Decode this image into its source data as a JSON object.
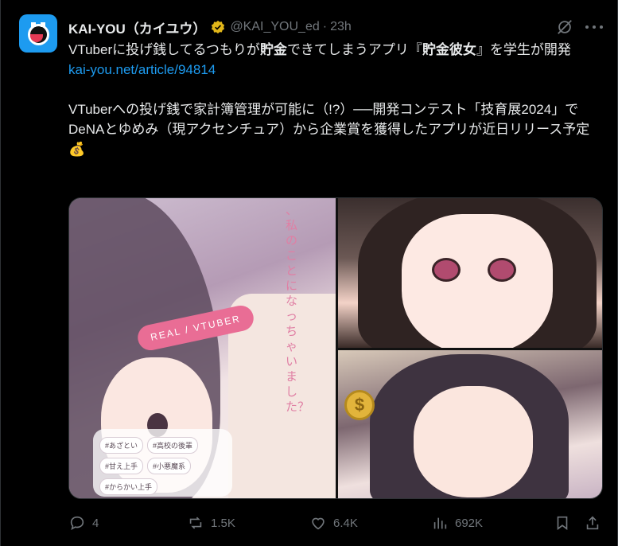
{
  "author": {
    "name": "KAI-YOU（カイユウ）",
    "handle": "@KAI_YOU_ed",
    "separator": "·",
    "time": "23h"
  },
  "tweet": {
    "line1_a": "VTuberに投げ銭してるつもりが",
    "line1_b": "貯金",
    "line1_c": "できてしまうアプリ『",
    "line1_d": "貯金彼女",
    "line1_e": "』を学生が開発",
    "link": "kai-you.net/article/94814",
    "para2": "VTuberへの投げ銭で家計簿管理が可能に（!?）──開発コンテスト「技育展2024」でDeNAとゆめみ（現アクセンチュア）から企業賞を獲得したアプリが近日リリース予定💰"
  },
  "media": {
    "img1": {
      "vertical_text": "、私のことになっちゃいました？",
      "pill": "REAL / VTUBER",
      "tags": [
        "#あざとい",
        "#高校の後輩",
        "#甘え上手",
        "#小悪魔系",
        "#からかい上手"
      ]
    },
    "img3": {
      "coin": "$"
    }
  },
  "actions": {
    "replies": "4",
    "reposts": "1.5K",
    "likes": "6.4K",
    "views": "692K"
  },
  "colors": {
    "background": "#000000",
    "text": "#e7e9ea",
    "muted": "#71767b",
    "link": "#1d9bf0",
    "avatar": "#1d9bf0",
    "pill": "#e96d95"
  }
}
